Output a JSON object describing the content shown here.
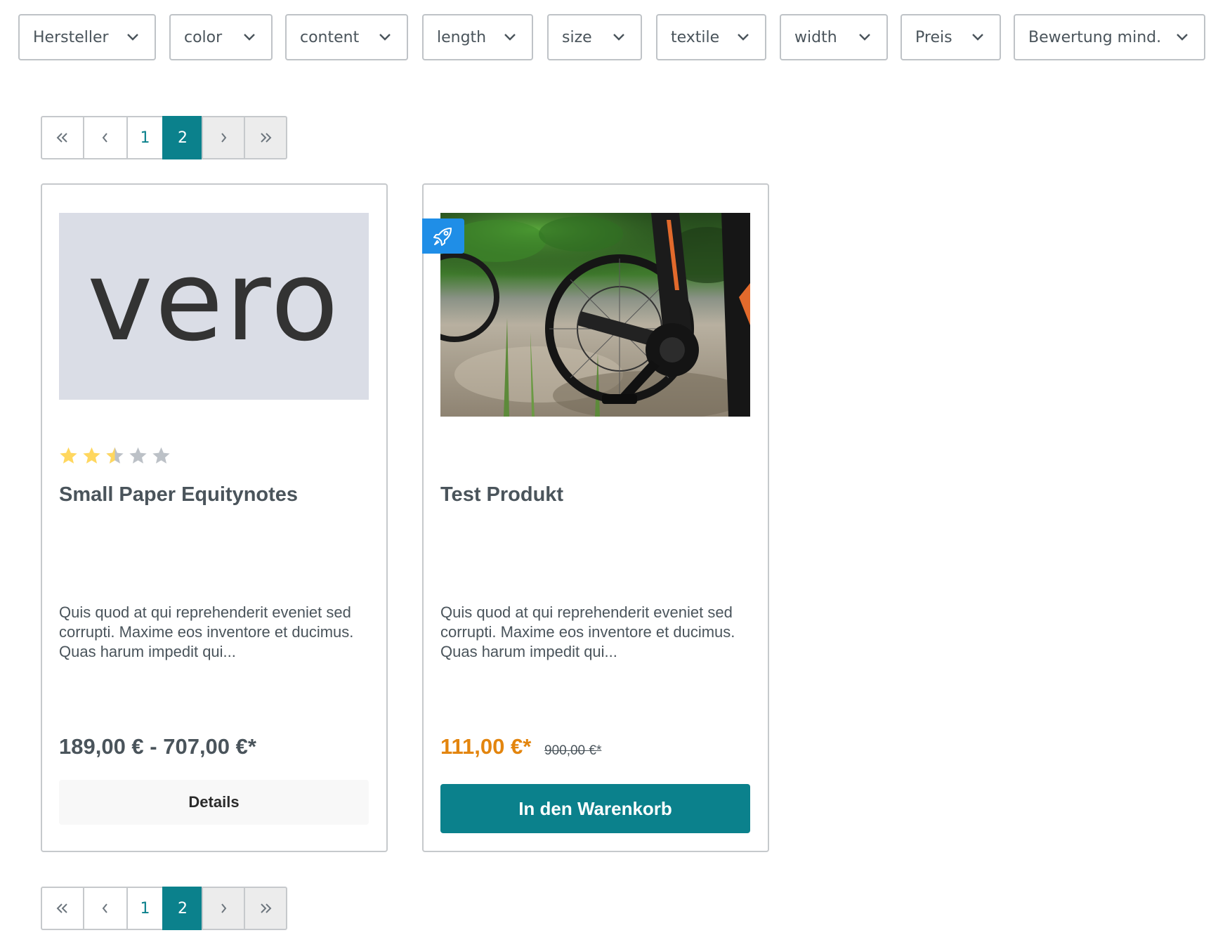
{
  "filters": [
    {
      "label": "Hersteller"
    },
    {
      "label": "color"
    },
    {
      "label": "content"
    },
    {
      "label": "length"
    },
    {
      "label": "size"
    },
    {
      "label": "textile"
    },
    {
      "label": "width"
    },
    {
      "label": "Preis"
    },
    {
      "label": "Bewertung mind."
    }
  ],
  "pagination": {
    "pages": [
      "1",
      "2"
    ],
    "current": "2",
    "first_icon": "double-chevron-left-icon",
    "prev_icon": "chevron-left-icon",
    "next_icon": "chevron-right-icon",
    "last_icon": "double-chevron-right-icon"
  },
  "products": [
    {
      "image_text": "vero",
      "rating": 2.5,
      "rating_max": 5,
      "title": "Small Paper Equitynotes",
      "description": "Quis quod at qui reprehenderit eveniet sed corrupti. Maxime eos inventore et ducimus. Quas harum impedit qui...",
      "price": "189,00 € - 707,00 €*",
      "button": "Details"
    },
    {
      "image": "e-bike photo",
      "badge_icon": "rocket-icon",
      "title": "Test Produkt",
      "description": "Quis quod at qui reprehenderit eveniet sed corrupti. Maxime eos inventore et ducimus. Quas harum impedit qui...",
      "price": "111,00 €*",
      "old_price": "900,00 €*",
      "button": "In den Warenkorb"
    }
  ],
  "colors": {
    "accent": "#0b818c",
    "sale": "#e3850e",
    "badge": "#1f8ee7",
    "star_filled": "#ffd75f",
    "star_empty": "#bcc1c7",
    "border": "#c6c9cc"
  }
}
